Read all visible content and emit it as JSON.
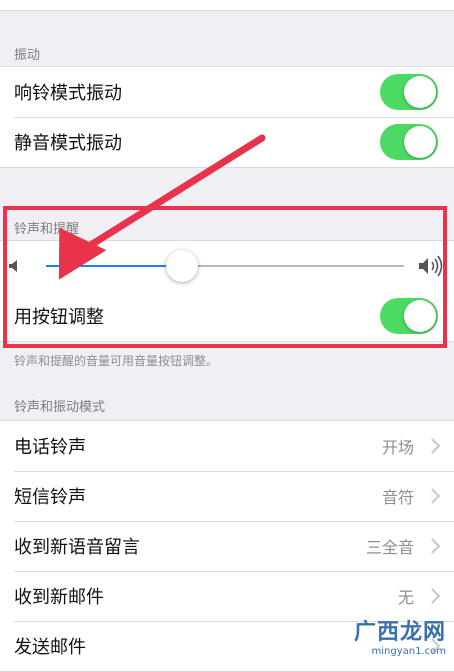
{
  "vibrate": {
    "header": "振动",
    "rows": [
      {
        "label": "响铃模式振动",
        "on": true
      },
      {
        "label": "静音模式振动",
        "on": true
      }
    ]
  },
  "ringer": {
    "header": "铃声和提醒",
    "slider_value_fraction": 0.38,
    "use_buttons_label": "用按钮调整",
    "use_buttons_on": true,
    "footer": "铃声和提醒的音量可用音量按钮调整。"
  },
  "sounds": {
    "header": "铃声和振动模式",
    "rows": [
      {
        "label": "电话铃声",
        "value": "开场"
      },
      {
        "label": "短信铃声",
        "value": "音符"
      },
      {
        "label": "收到新语音留言",
        "value": "三全音"
      },
      {
        "label": "收到新邮件",
        "value": "无"
      },
      {
        "label": "发送邮件",
        "value": ""
      }
    ]
  },
  "watermark": {
    "main": "广西龙网",
    "url": "mingyan1.com"
  },
  "colors": {
    "toggle_on": "#4cd964",
    "slider_fill": "#1a7ff5",
    "highlight": "#e8334a"
  }
}
